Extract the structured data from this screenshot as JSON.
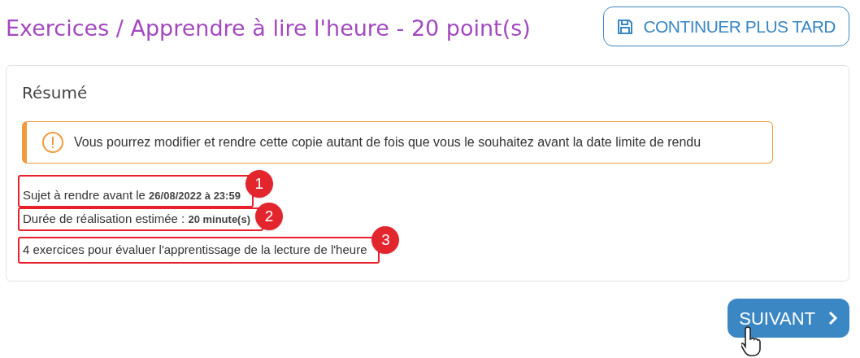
{
  "header": {
    "title": "Exercices / Apprendre à lire l'heure - 20 point(s)",
    "save_button": "CONTINUER PLUS TARD"
  },
  "summary": {
    "heading": "Résumé",
    "alert": "Vous pourrez modifier et rendre cette copie autant de fois que vous le souhaitez avant la date limite de rendu",
    "lines": [
      {
        "text": "Sujet à rendre avant le **26/08/2022 à 23:59**",
        "marker": "1"
      },
      {
        "text": "Durée de réalisation estimée : **20 minute(s)**",
        "marker": "2"
      },
      {
        "text": "4 exercices pour évaluer l'apprentissage de la lecture de l'heure",
        "marker": "3"
      }
    ]
  },
  "next_button": "SUIVANT"
}
